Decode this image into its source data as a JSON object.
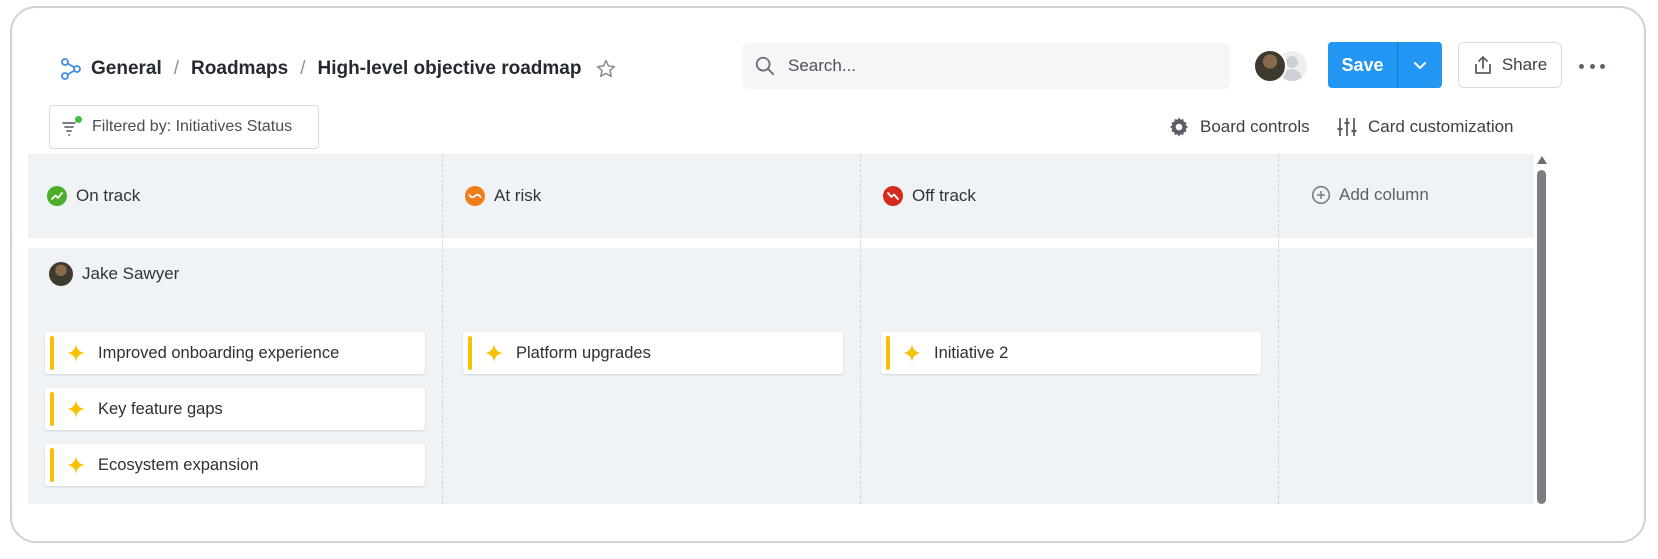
{
  "header": {
    "breadcrumb": [
      "General",
      "Roadmaps",
      "High-level objective roadmap"
    ],
    "breadcrumb_separator": "/",
    "logo_icon": "roadmap-nodes-icon",
    "search_placeholder": "Search...",
    "save_label": "Save",
    "share_label": "Share",
    "accent_color": "#2196f3"
  },
  "toolbar": {
    "filter_label": "Filtered by: Initiatives Status",
    "board_controls_label": "Board controls",
    "card_customization_label": "Card customization"
  },
  "board": {
    "columns": [
      {
        "label": "On track",
        "icon": "trend-up-icon",
        "color": "#4caf2c"
      },
      {
        "label": "At risk",
        "icon": "wave-icon",
        "color": "#f07c1c"
      },
      {
        "label": "Off track",
        "icon": "trend-down-icon",
        "color": "#d52b1e"
      }
    ],
    "add_column_label": "Add column",
    "owner": "Jake Sawyer",
    "cards": {
      "on_track": [
        "Improved onboarding experience",
        "Key feature gaps",
        "Ecosystem expansion"
      ],
      "at_risk": [
        "Platform upgrades"
      ],
      "off_track": [
        "Initiative 2"
      ]
    },
    "card_icon": "initiative-star-icon",
    "card_color": "#f6c100"
  }
}
